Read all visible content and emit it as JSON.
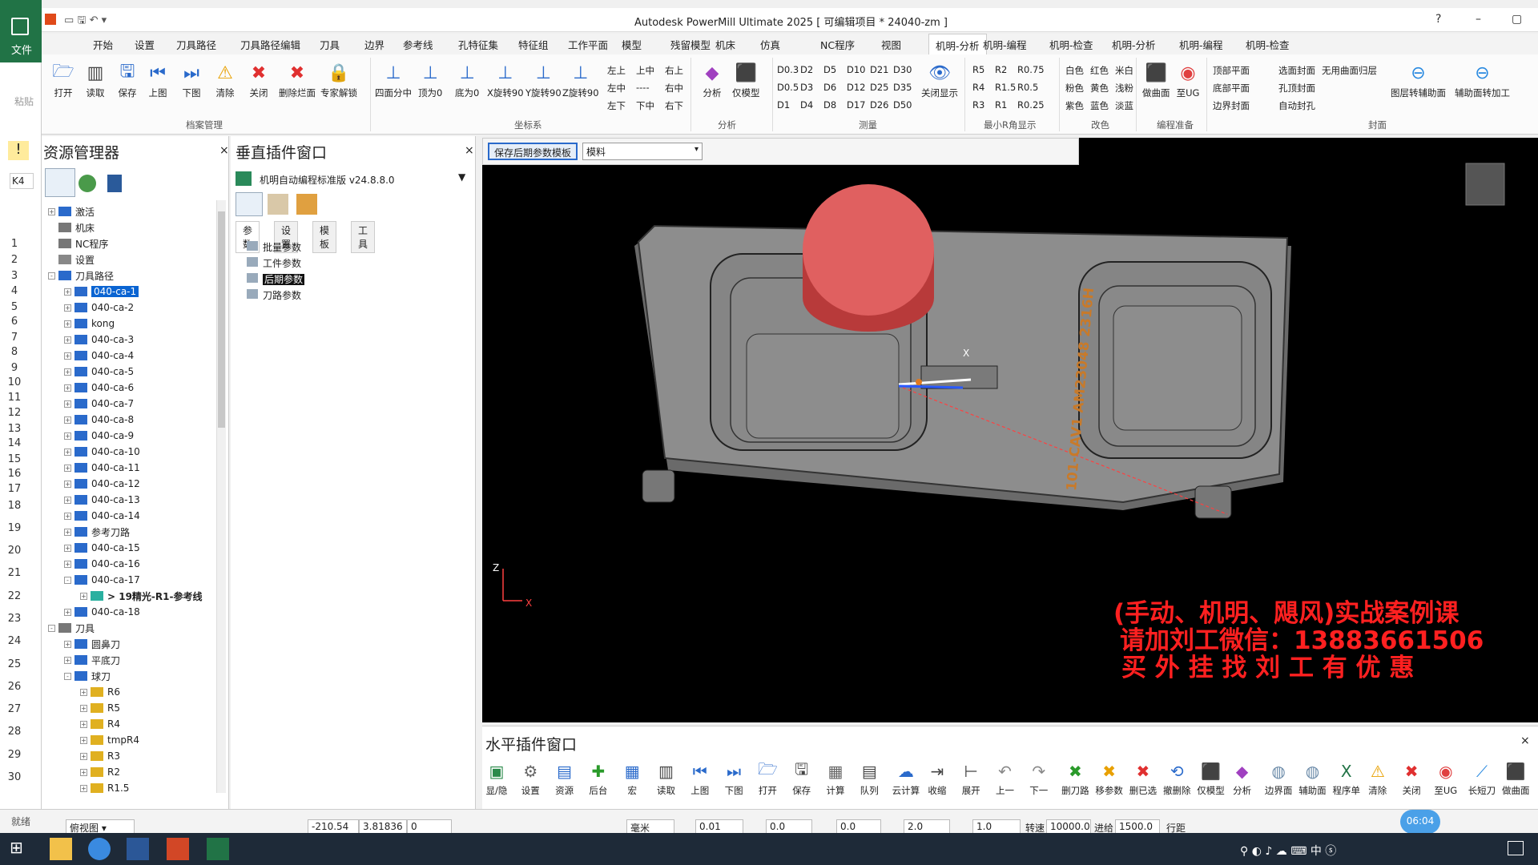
{
  "app": {
    "title": "Autodesk PowerMill Ultimate 2025   [ 可编辑项目 * 24040-zm ]"
  },
  "menu": {
    "file": "文件",
    "items": [
      "开始",
      "设置",
      "刀具路径",
      "刀具路径编辑",
      "刀具",
      "边界",
      "参考线",
      "孔特征集",
      "特征组",
      "工作平面",
      "模型",
      "残留模型",
      "机床",
      "仿真",
      "NC程序",
      "视图",
      "机明-分析",
      "机明-编程",
      "机明-检查",
      "机明-分析",
      "机明-编程",
      "机明-检查"
    ]
  },
  "ribbon": {
    "file_group": {
      "label": "档案管理",
      "buttons": [
        "打开",
        "读取",
        "保存",
        "上图",
        "下图",
        "清除",
        "关闭",
        "删除烂面",
        "专家解锁"
      ]
    },
    "coord_group": {
      "label": "坐标系",
      "buttons": [
        "四面分中",
        "顶为0",
        "底为0",
        "X旋转90",
        "Y旋转90",
        "Z旋转90"
      ],
      "small": [
        "左上",
        "上中",
        "右上",
        "左中",
        "----",
        "右中",
        "左下",
        "下中",
        "右下"
      ]
    },
    "analysis_group": {
      "label": "分析",
      "buttons": [
        "分析",
        "仅模型"
      ]
    },
    "measure_group": {
      "label": "测量",
      "small": [
        "D0.3",
        "D2",
        "D5",
        "D10",
        "D21",
        "D30",
        "D0.5",
        "D3",
        "D6",
        "D12",
        "D25",
        "D35",
        "D1",
        "D4",
        "D8",
        "D17",
        "D26",
        "D50"
      ],
      "toggle": "关闭显示"
    },
    "minr_group": {
      "label": "最小R角显示",
      "small": [
        "R5",
        "R2",
        "R0.75",
        "R4",
        "R1.5",
        "R0.5",
        "R3",
        "R1",
        "R0.25"
      ]
    },
    "color_group": {
      "label": "改色",
      "small": [
        "白色",
        "红色",
        "米白",
        "粉色",
        "黄色",
        "浅粉",
        "紫色",
        "蓝色",
        "淡蓝"
      ]
    },
    "prep_group": {
      "label": "编程准备",
      "buttons": [
        "做曲面",
        "至UG"
      ]
    },
    "seal_group": {
      "label": "封面",
      "small": [
        "顶部平面",
        "选面封面",
        "无用曲面归层",
        "底部平面",
        "孔顶封面",
        "边界封面",
        "自动封孔"
      ],
      "buttons": [
        "图层转辅助面",
        "辅助面转加工"
      ]
    }
  },
  "excel": {
    "cell_ref": "K4",
    "rows": [
      "1",
      "2",
      "3",
      "4",
      "5",
      "6",
      "7",
      "8",
      "9",
      "10",
      "11",
      "12",
      "13",
      "14",
      "15",
      "16",
      "17",
      "18",
      "19",
      "20",
      "21",
      "22",
      "23",
      "24",
      "25",
      "26",
      "27",
      "28",
      "29",
      "30"
    ],
    "paste": "粘贴",
    "file_tab": "文件",
    "status": "就绪"
  },
  "resource": {
    "title": "资源管理器",
    "tree": [
      {
        "label": "激活",
        "level": 0,
        "exp": "+",
        "icon": "activate"
      },
      {
        "label": "机床",
        "level": 0,
        "exp": "",
        "icon": "machine"
      },
      {
        "label": "NC程序",
        "level": 0,
        "exp": "",
        "icon": "nc"
      },
      {
        "label": "设置",
        "level": 0,
        "exp": "",
        "icon": "setting"
      },
      {
        "label": "刀具路径",
        "level": 0,
        "exp": "-",
        "icon": "toolpath"
      },
      {
        "label": "040-ca-1",
        "level": 1,
        "exp": "+",
        "icon": "folder",
        "sel": true
      },
      {
        "label": "040-ca-2",
        "level": 1,
        "exp": "+",
        "icon": "folder"
      },
      {
        "label": "kong",
        "level": 1,
        "exp": "+",
        "icon": "folder"
      },
      {
        "label": "040-ca-3",
        "level": 1,
        "exp": "+",
        "icon": "folder"
      },
      {
        "label": "040-ca-4",
        "level": 1,
        "exp": "+",
        "icon": "folder"
      },
      {
        "label": "040-ca-5",
        "level": 1,
        "exp": "+",
        "icon": "folder"
      },
      {
        "label": "040-ca-6",
        "level": 1,
        "exp": "+",
        "icon": "folder"
      },
      {
        "label": "040-ca-7",
        "level": 1,
        "exp": "+",
        "icon": "folder"
      },
      {
        "label": "040-ca-8",
        "level": 1,
        "exp": "+",
        "icon": "folder"
      },
      {
        "label": "040-ca-9",
        "level": 1,
        "exp": "+",
        "icon": "folder"
      },
      {
        "label": "040-ca-10",
        "level": 1,
        "exp": "+",
        "icon": "folder"
      },
      {
        "label": "040-ca-11",
        "level": 1,
        "exp": "+",
        "icon": "folder"
      },
      {
        "label": "040-ca-12",
        "level": 1,
        "exp": "+",
        "icon": "folder"
      },
      {
        "label": "040-ca-13",
        "level": 1,
        "exp": "+",
        "icon": "folder"
      },
      {
        "label": "040-ca-14",
        "level": 1,
        "exp": "+",
        "icon": "folder"
      },
      {
        "label": "参考刀路",
        "level": 1,
        "exp": "+",
        "icon": "folder"
      },
      {
        "label": "040-ca-15",
        "level": 1,
        "exp": "+",
        "icon": "folder"
      },
      {
        "label": "040-ca-16",
        "level": 1,
        "exp": "+",
        "icon": "folder"
      },
      {
        "label": "040-ca-17",
        "level": 1,
        "exp": "-",
        "icon": "folder"
      },
      {
        "label": "> 19精光-R1-参考线",
        "level": 2,
        "exp": "+",
        "icon": "path",
        "bold": true
      },
      {
        "label": "040-ca-18",
        "level": 1,
        "exp": "+",
        "icon": "folder"
      },
      {
        "label": "刀具",
        "level": 0,
        "exp": "-",
        "icon": "tool"
      },
      {
        "label": "圆鼻刀",
        "level": 1,
        "exp": "+",
        "icon": "folder"
      },
      {
        "label": "平底刀",
        "level": 1,
        "exp": "+",
        "icon": "folder"
      },
      {
        "label": "球刀",
        "level": 1,
        "exp": "-",
        "icon": "folder"
      },
      {
        "label": "R6",
        "level": 2,
        "exp": "+",
        "icon": "cutter"
      },
      {
        "label": "R5",
        "level": 2,
        "exp": "+",
        "icon": "cutter"
      },
      {
        "label": "R4",
        "level": 2,
        "exp": "+",
        "icon": "cutter"
      },
      {
        "label": "tmpR4",
        "level": 2,
        "exp": "+",
        "icon": "cutter"
      },
      {
        "label": "R3",
        "level": 2,
        "exp": "+",
        "icon": "cutter"
      },
      {
        "label": "R2",
        "level": 2,
        "exp": "+",
        "icon": "cutter"
      },
      {
        "label": "R1.5",
        "level": 2,
        "exp": "+",
        "icon": "cutter"
      }
    ]
  },
  "vplugin": {
    "title": "垂直插件窗口",
    "plugin_name": "机明自动编程标准版 v24.8.8.0",
    "tabs": [
      "参数",
      "设置",
      "模板",
      "工具"
    ],
    "items": [
      "批量参数",
      "工件参数",
      "后期参数",
      "刀路参数"
    ],
    "selected_item": "后期参数"
  },
  "viewport_toolbar": {
    "save_button": "保存后期参数模板",
    "dropdown_value": "模料"
  },
  "viewport": {
    "part_label": "101-CAV1 AM23048  2316H",
    "axis_x": "X",
    "axis_z": "Z",
    "overlay_lines": [
      "(手动、机明、飓风)实战案例课",
      "请加刘工微信：13883661506",
      "买 外 挂 找 刘 工 有 优 惠"
    ]
  },
  "hplugin": {
    "title": "水平插件窗口",
    "buttons": [
      "显/隐",
      "设置",
      "资源",
      "后台",
      "宏",
      "读取",
      "上图",
      "下图",
      "打开",
      "保存",
      "计算",
      "队列",
      "云计算",
      "收缩",
      "展开",
      "上一",
      "下一",
      "删刀路",
      "移参数",
      "删已选",
      "撤删除",
      "仅模型",
      "分析",
      "边界面",
      "辅助面",
      "程序单",
      "清除",
      "关闭",
      "至UG",
      "长短刀",
      "做曲面"
    ]
  },
  "status": {
    "view": "俯视图",
    "x": "-210.54",
    "y": "3.81836",
    "z": "0",
    "units": "毫米",
    "tol": "0.01",
    "thick": "0.0",
    "tool_len": "0.0",
    "dia": "2.0",
    "angle": "1.0",
    "spindle_label": "转速",
    "spindle": "10000.0",
    "feed_label": "进给",
    "feed": "1500.0",
    "row_label": "行距",
    "time": "06:04"
  },
  "colors": {
    "accent": "#0a64d2",
    "tool_red": "#e05a5a",
    "overlay_red": "#ff2020",
    "part_grey": "#8a8a8a"
  }
}
